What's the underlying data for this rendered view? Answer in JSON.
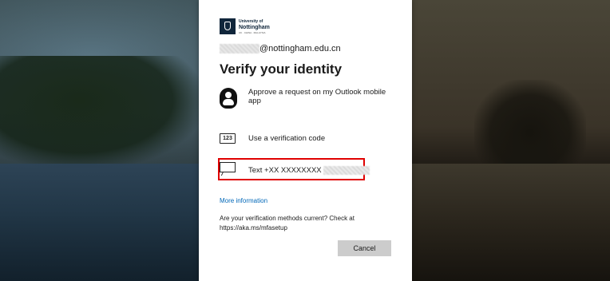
{
  "logo": {
    "line1": "University of",
    "line2": "Nottingham",
    "line3": "UK · CHINA · MALAYSIA"
  },
  "email": {
    "domain": "@nottingham.edu.cn"
  },
  "title": "Verify your identity",
  "options": [
    {
      "icon": "person-icon",
      "label": "Approve a request on my Outlook mobile app"
    },
    {
      "icon": "code-icon",
      "icon_text": "123",
      "label": "Use a verification code"
    },
    {
      "icon": "sms-icon",
      "label": "Text +XX XXXXXXXX"
    }
  ],
  "more_info": "More information",
  "methods_check": "Are your verification methods current? Check at https://aka.ms/mfasetup",
  "cancel_label": "Cancel",
  "colors": {
    "link": "#0067b8",
    "highlight": "#e00000",
    "button_bg": "#cccccc"
  }
}
